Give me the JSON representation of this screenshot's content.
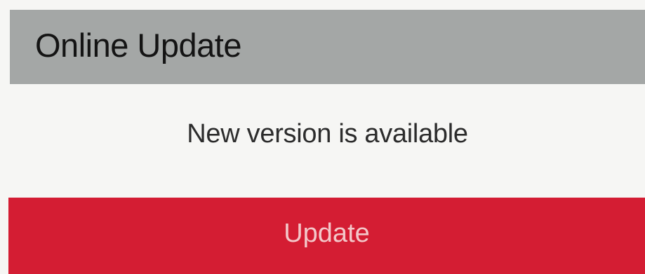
{
  "dialog": {
    "title": "Online Update",
    "message": "New version is available",
    "button_label": "Update"
  },
  "colors": {
    "title_bar": "#a4a7a6",
    "background": "#f6f6f4",
    "button": "#d41d33",
    "button_text": "#f3c7c9"
  }
}
